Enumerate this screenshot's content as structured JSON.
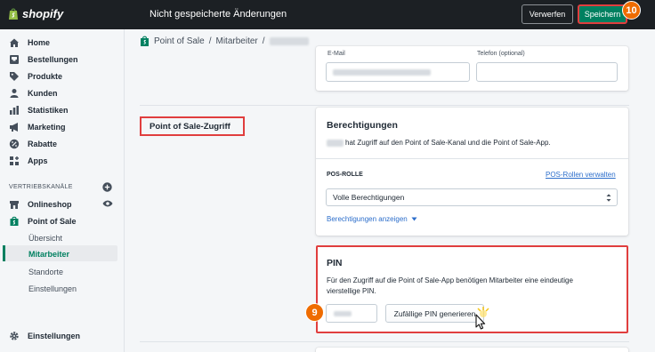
{
  "topbar": {
    "logo_text": "shopify",
    "unsaved_title": "Nicht gespeicherte Änderungen",
    "discard_label": "Verwerfen",
    "save_label": "Speichern",
    "save_step": "10"
  },
  "sidebar": {
    "items": [
      {
        "label": "Home",
        "icon": "home-icon"
      },
      {
        "label": "Bestellungen",
        "icon": "orders-icon"
      },
      {
        "label": "Produkte",
        "icon": "tag-icon"
      },
      {
        "label": "Kunden",
        "icon": "person-icon"
      },
      {
        "label": "Statistiken",
        "icon": "bar-chart-icon"
      },
      {
        "label": "Marketing",
        "icon": "megaphone-icon"
      },
      {
        "label": "Rabatte",
        "icon": "discount-icon"
      },
      {
        "label": "Apps",
        "icon": "apps-icon"
      }
    ],
    "sales_channels_title": "VERTRIEBSKANÄLE",
    "channels": [
      {
        "label": "Onlineshop",
        "icon": "store-icon"
      },
      {
        "label": "Point of Sale",
        "icon": "pos-bag-icon"
      }
    ],
    "sub_items": [
      "Übersicht",
      "Mitarbeiter",
      "Standorte",
      "Einstellungen"
    ],
    "active_sub_item": "Mitarbeiter",
    "settings_label": "Einstellungen"
  },
  "breadcrumb": {
    "part1": "Point of Sale",
    "separator": "/",
    "part2": "Mitarbeiter"
  },
  "top_card": {
    "email_label": "E-Mail",
    "phone_label": "Telefon (optional)"
  },
  "pos_section": {
    "title": "Point of Sale-Zugriff"
  },
  "permissions_card": {
    "title": "Berechtigungen",
    "access_text": "hat Zugriff auf den Point of Sale-Kanal und die Point of Sale-App.",
    "role_label": "POS-ROLLE",
    "manage_roles_link": "POS-Rollen verwalten",
    "role_value": "Volle Berechtigungen",
    "show_permissions_link": "Berechtigungen anzeigen"
  },
  "pin_card": {
    "title": "PIN",
    "description_line1": "Für den Zugriff auf die Point of Sale-App benötigen Mitarbeiter eine eindeutige",
    "description_line2": "vierstellige PIN.",
    "generate_button": "Zufällige PIN generieren",
    "step": "9"
  },
  "colors": {
    "topbar": "#1c2024",
    "primary": "#008060",
    "highlight": "#e03e3e",
    "step_badge": "#ef6c00",
    "link": "#2c6ecb"
  }
}
